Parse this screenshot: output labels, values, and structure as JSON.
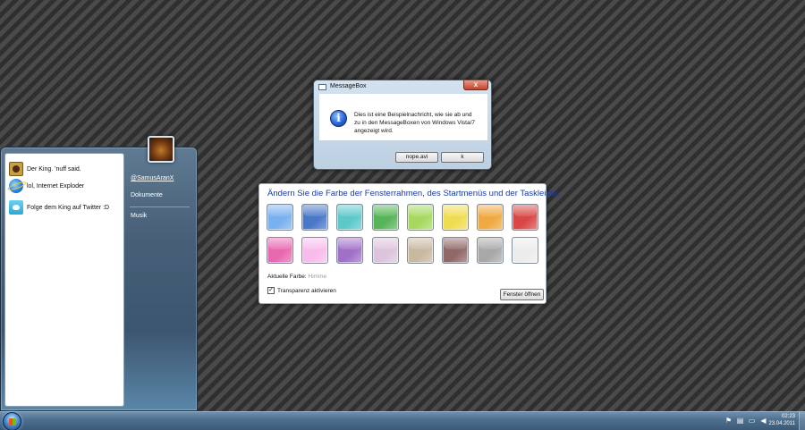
{
  "start_menu": {
    "programs": [
      {
        "label": "Der King. 'nuff said.",
        "icon": "king-icon"
      },
      {
        "label": "lol, Internet Exploder",
        "icon": "internet-explorer-icon"
      },
      {
        "label": "Folge dem King auf Twitter :D",
        "icon": "twitter-icon"
      }
    ],
    "user_link": "@SamusAranX",
    "links": [
      "Dokumente",
      "Musik"
    ]
  },
  "messagebox": {
    "title": "MessageBox",
    "close_glyph": "x",
    "text": "Dies ist eine Beispielnachricht, wie sie ab und zu in den MessageBoxen von Windows Vista/7 angezeigt wird.",
    "buttons": [
      "nope.avi",
      "k"
    ]
  },
  "color_dialog": {
    "heading": "Ändern Sie die Farbe der Fensterrahmen, des Startmenüs und der Taskleiste.",
    "swatches": [
      "#78b0f0",
      "#4a78c8",
      "#5cc8c8",
      "#58b458",
      "#a6d860",
      "#f0dc50",
      "#f0a840",
      "#d84848",
      "#e868b0",
      "#f8bcec",
      "#a070c8",
      "#dcc4dc",
      "#c8b8a0",
      "#906868",
      "#a8a8a8",
      "#ececec"
    ],
    "current_color_label": "Aktuelle Farbe:",
    "current_color_value": "Himme",
    "transparency_label": "Transparenz aktivieren",
    "transparency_checked": true,
    "open_window_button": "Fenster öffnen"
  },
  "taskbar": {
    "clock_time": "02:23",
    "clock_date": "23.04.2011",
    "tray_icons": [
      "flag-icon",
      "network-icon",
      "battery-icon",
      "speaker-icon"
    ]
  }
}
